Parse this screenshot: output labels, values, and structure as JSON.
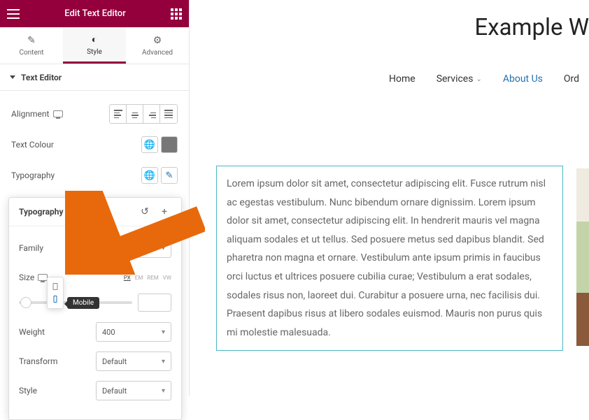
{
  "header": {
    "title": "Edit Text Editor"
  },
  "tabs": {
    "content": "Content",
    "style": "Style",
    "advanced": "Advanced"
  },
  "section": {
    "title": "Text Editor"
  },
  "controls": {
    "alignment": "Alignment",
    "text_colour": "Text Colour",
    "typography": "Typography"
  },
  "popover": {
    "title": "Typography",
    "family": "Family",
    "family_value": "",
    "size": "Size",
    "units": {
      "px": "PX",
      "em": "EM",
      "rem": "REM",
      "vw": "VW"
    },
    "weight": "Weight",
    "weight_value": "400",
    "transform": "Transform",
    "transform_value": "Default",
    "style": "Style",
    "style_value": "Default"
  },
  "tooltip": "Mobile",
  "preview": {
    "site_title": "Example W",
    "nav": {
      "home": "Home",
      "services": "Services",
      "about": "About Us",
      "order": "Ord"
    },
    "body": "Lorem ipsum dolor sit amet, consectetur adipiscing elit. Fusce rutrum nisl ac egestas vestibulum. Nunc bibendum ornare dignissim. Lorem ipsum dolor sit amet, consectetur adipiscing elit. In hendrerit mauris vel magna aliquam sodales et ut tellus. Sed posuere metus sed dapibus blandit. Sed pharetra non magna et ornare. Vestibulum ante ipsum primis in faucibus orci luctus et ultrices posuere cubilia curae; Vestibulum a erat sodales, sodales risus non, laoreet dui. Curabitur a posuere urna, nec facilisis dui. Praesent dapibus risus at libero sodales euismod. Mauris non purus quis mi molestie malesuada."
  }
}
